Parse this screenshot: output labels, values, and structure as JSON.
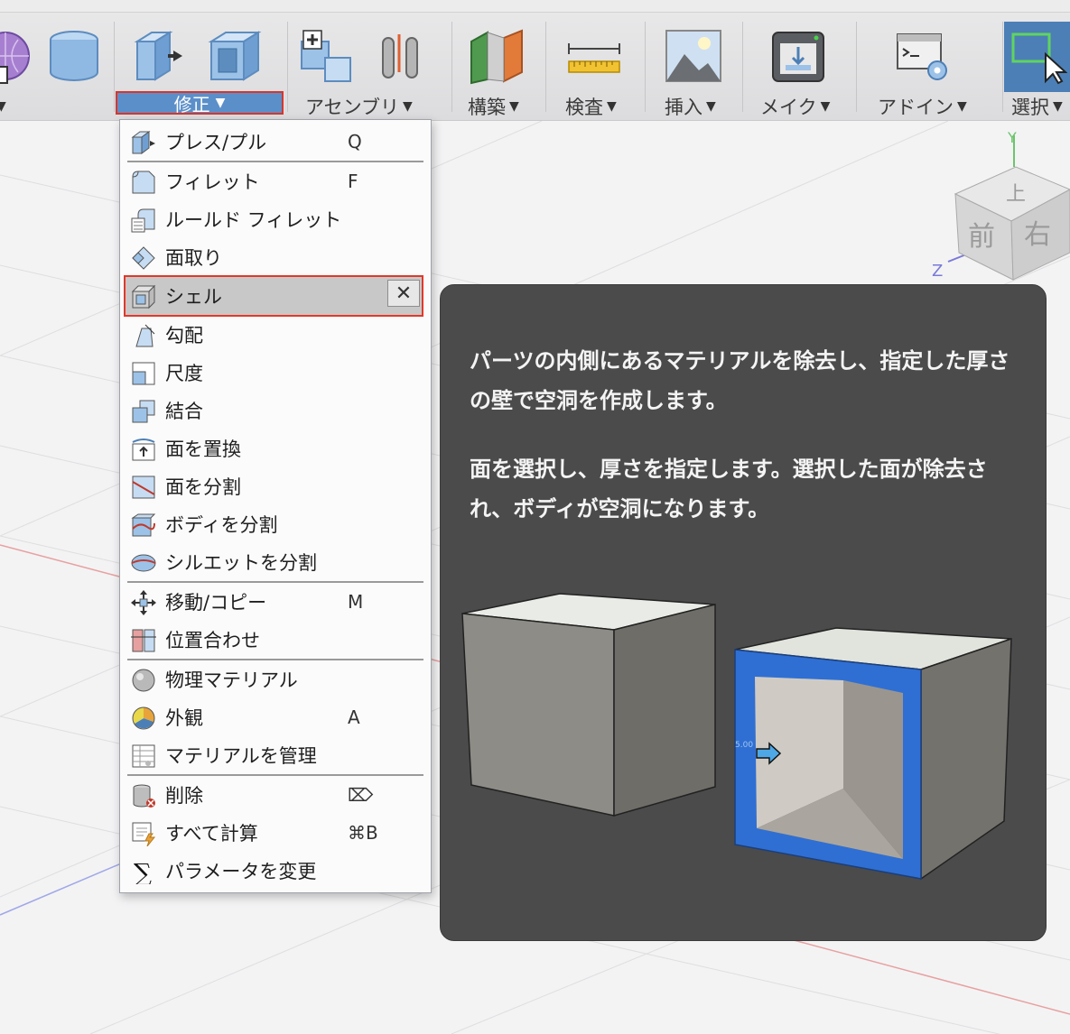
{
  "toolbar": {
    "groups": [
      {
        "label": "",
        "icon": "create-icons"
      },
      {
        "label": "修正",
        "icon": "modify-icons"
      },
      {
        "label": "アセンブリ",
        "icon": "assemble-icons"
      },
      {
        "label": "構築",
        "icon": "construct-icon"
      },
      {
        "label": "検査",
        "icon": "inspect-ruler-icon"
      },
      {
        "label": "挿入",
        "icon": "insert-image-icon"
      },
      {
        "label": "メイク",
        "icon": "make-3dprint-icon"
      },
      {
        "label": "アドイン",
        "icon": "addins-script-icon"
      },
      {
        "label": "選択",
        "icon": "select-window-icon"
      }
    ],
    "caret": "▼"
  },
  "menu": {
    "items": [
      {
        "label": "プレス/プル",
        "key": "Q",
        "icon": "press-pull-icon"
      },
      {
        "label": "フィレット",
        "key": "F",
        "icon": "fillet-icon"
      },
      {
        "label": "ルールド フィレット",
        "key": "",
        "icon": "rule-fillet-icon"
      },
      {
        "label": "面取り",
        "key": "",
        "icon": "chamfer-icon"
      },
      {
        "label": "シェル",
        "key": "",
        "icon": "shell-icon",
        "close": "✕"
      },
      {
        "label": "勾配",
        "key": "",
        "icon": "draft-icon"
      },
      {
        "label": "尺度",
        "key": "",
        "icon": "scale-icon"
      },
      {
        "label": "結合",
        "key": "",
        "icon": "combine-icon"
      },
      {
        "label": "面を置換",
        "key": "",
        "icon": "replace-face-icon"
      },
      {
        "label": "面を分割",
        "key": "",
        "icon": "split-face-icon"
      },
      {
        "label": "ボディを分割",
        "key": "",
        "icon": "split-body-icon"
      },
      {
        "label": "シルエットを分割",
        "key": "",
        "icon": "silhouette-split-icon"
      },
      {
        "label": "移動/コピー",
        "key": "M",
        "icon": "move-icon"
      },
      {
        "label": "位置合わせ",
        "key": "",
        "icon": "align-icon"
      },
      {
        "label": "物理マテリアル",
        "key": "",
        "icon": "physical-material-icon"
      },
      {
        "label": "外観",
        "key": "A",
        "icon": "appearance-icon"
      },
      {
        "label": "マテリアルを管理",
        "key": "",
        "icon": "manage-materials-icon"
      },
      {
        "label": "削除",
        "key": "⌦",
        "icon": "delete-icon"
      },
      {
        "label": "すべて計算",
        "key": "⌘B",
        "icon": "compute-all-icon"
      },
      {
        "label": "パラメータを変更",
        "key": "",
        "icon": "change-parameters-icon"
      }
    ]
  },
  "tooltip": {
    "paragraph1": "パーツの内側にあるマテリアルを除去し、指定した厚さの壁で空洞を作成します。",
    "paragraph2": "面を選択し、厚さを指定します。選択した面が除去され、ボディが空洞になります。",
    "dimension_label": "5.00"
  },
  "viewcube": {
    "top": "上",
    "front": "前",
    "right": "右",
    "axis_y": "Y",
    "axis_z": "Z"
  },
  "colors": {
    "highlight_red": "#e0392b",
    "toolbar_blue": "#5b8fc9",
    "tooltip_bg": "#4b4b4b",
    "shell_face_blue": "#2f6fd4"
  }
}
